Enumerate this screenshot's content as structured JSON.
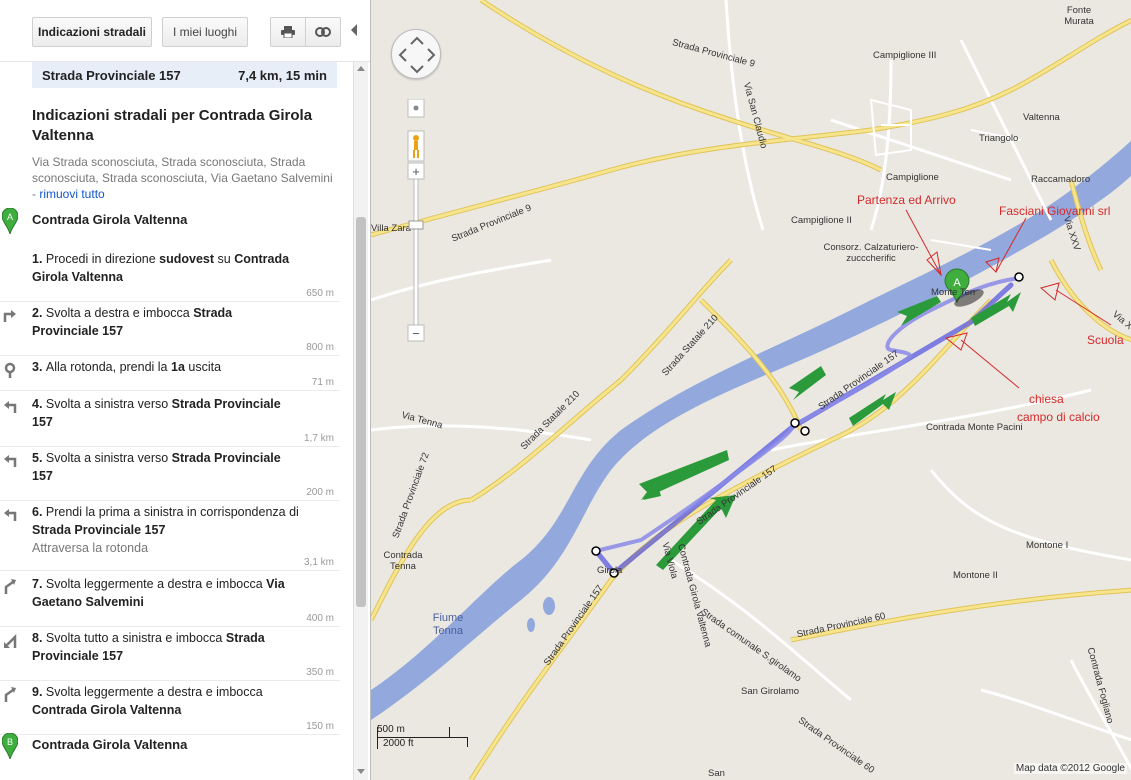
{
  "toolbar": {
    "directions_label": "Indicazioni stradali",
    "places_label": "I miei luoghi",
    "print_icon": "printer-icon",
    "link_icon": "link-icon"
  },
  "route_summary": {
    "road": "Strada Provinciale 157",
    "distance_time": "7,4 km, 15 min"
  },
  "directions": {
    "title": "Indicazioni stradali per Contrada Girola Valtenna",
    "via": "Via Strada sconosciuta, Strada sconosciuta, Strada sconosciuta, Strada sconosciuta, Via Gaetano Salvemini",
    "separator": " - ",
    "remove_all": "rimuovi tutto",
    "start": {
      "marker": "A",
      "name": "Contrada Girola Valtenna"
    },
    "end": {
      "marker": "B",
      "name": "Contrada Girola Valtenna"
    },
    "steps": [
      {
        "num": "1.",
        "parts": [
          "Procedi in direzione ",
          "sudovest",
          " su "
        ],
        "bold": "Contrada Girola Valtenna",
        "dist": "650 m",
        "icon": "none"
      },
      {
        "num": "2.",
        "parts": [
          "Svolta a destra e imbocca "
        ],
        "bold": "Strada Provinciale 157",
        "dist": "800 m",
        "icon": "turn-right-icon"
      },
      {
        "num": "3.",
        "parts": [
          "Alla rotonda, prendi la "
        ],
        "bold": "1a",
        "after": " uscita",
        "dist": "71 m",
        "icon": "roundabout-icon"
      },
      {
        "num": "4.",
        "parts": [
          "Svolta a sinistra verso "
        ],
        "bold": "Strada Provinciale 157",
        "dist": "1,7 km",
        "icon": "turn-left-icon"
      },
      {
        "num": "5.",
        "parts": [
          "Svolta a sinistra verso "
        ],
        "bold": "Strada Provinciale 157",
        "dist": "200 m",
        "icon": "turn-left-icon"
      },
      {
        "num": "6.",
        "parts": [
          "Prendi la prima a sinistra in corrispondenza di "
        ],
        "bold": "Strada Provinciale 157",
        "note": "Attraversa la rotonda",
        "dist": "3,1 km",
        "icon": "turn-left-icon"
      },
      {
        "num": "7.",
        "parts": [
          "Svolta leggermente a destra e imbocca "
        ],
        "bold": "Via Gaetano Salvemini",
        "dist": "400 m",
        "icon": "slight-right-icon"
      },
      {
        "num": "8.",
        "parts": [
          "Svolta tutto a sinistra e imbocca "
        ],
        "bold": "Strada Provinciale 157",
        "dist": "350 m",
        "icon": "sharp-left-icon"
      },
      {
        "num": "9.",
        "parts": [
          "Svolta leggermente a destra e imbocca "
        ],
        "bold": "Contrada Girola Valtenna",
        "dist": "150 m",
        "icon": "slight-right-icon"
      }
    ]
  },
  "map": {
    "colors": {
      "land": "#ebe8e2",
      "river": "#93a8dd",
      "main_road": "#f6e58d",
      "road_stroke": "#e0c35a",
      "minor_road": "#ffffff",
      "route": "#7b7be8",
      "arrows": "#2a9a3a",
      "annotation": "#d42a2a"
    },
    "labels": [
      "Fonte Murata",
      "Strada Provinciale 9",
      "Campiglione III",
      "Via San Claudio",
      "Valtenna",
      "Triangolo",
      "Campiglione",
      "Raccamadoro",
      "Strada Provinciale 9",
      "Campiglione II",
      "Villa Zara",
      "Consorz. Calzaturiero-zucccherific",
      "Via XXV",
      "Strada Statale 210",
      "Strada Statale 210",
      "Via Tenna",
      "Contrada Monte Pacini",
      "Strada Provinciale 72",
      "Strada Provinciale 157",
      "Strada Provinciale 157",
      "Via Viola",
      "Contrada Tenna",
      "Girola",
      "Montone I",
      "Contrada Girola Valtenna",
      "Montone II",
      "Fiume Tenna",
      "Strada Provinciale 157",
      "Strada comunale S.girolamo",
      "Strada Provinciale 60",
      "San Girolamo",
      "Strada Provinciale 60",
      "Contrada Fogliano",
      "Via X",
      "San",
      "Monte Ten"
    ],
    "annotations": {
      "start_end": "Partenza ed Arrivo",
      "company": "Fasciani Giovanni  srl",
      "school": "Scuola",
      "church": "chiesa",
      "field": "campo di calcio"
    },
    "start_marker": "A",
    "scale_m": "500 m",
    "scale_ft": "2000 ft",
    "copyright": "Map data ©2012 Google"
  }
}
